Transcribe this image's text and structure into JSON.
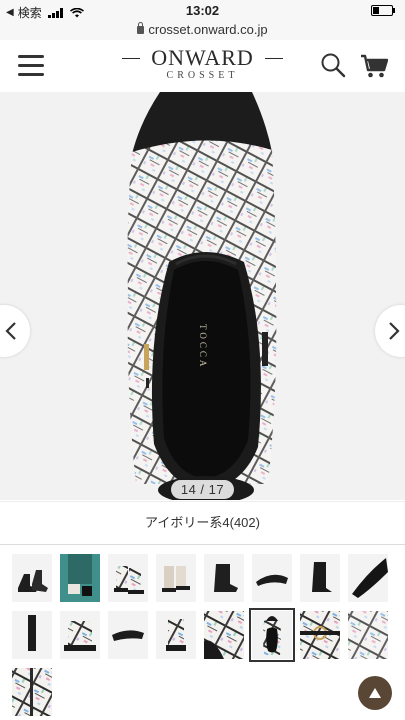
{
  "status_bar": {
    "back_label": "検索",
    "time": "13:02",
    "battery_level": 0.3
  },
  "url_bar": {
    "domain": "crosset.onward.co.jp"
  },
  "header": {
    "logo_main": "ONWARD",
    "logo_sub": "CROSSET"
  },
  "gallery": {
    "counter": "14 / 17",
    "current_index": 14,
    "total": 17,
    "brand_lining": "TOCCA"
  },
  "color_variant": {
    "label": "アイボリー系4(402)"
  },
  "thumbnails": {
    "count": 17,
    "selected_index": 14
  },
  "colors": {
    "accent_button": "#5a4634",
    "tweed_base": "#f4f2ef"
  }
}
